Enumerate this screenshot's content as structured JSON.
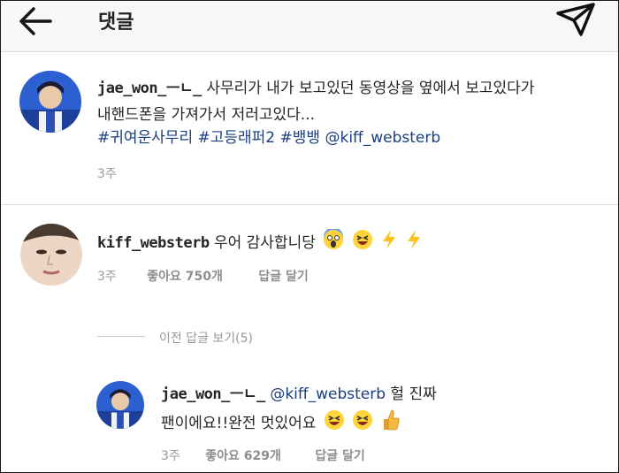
{
  "header": {
    "title": "댓글"
  },
  "caption": {
    "username": "jae_won_ㅡㄴ_",
    "text_line1": "사무리가 내가 보고있던 동영상을 옆에서 보고있다가",
    "text_line2": "내핸드폰을 가져가서 저러고있다...",
    "hashtags": [
      "#귀여운사무리",
      "#고등래퍼2",
      "#뱅뱅",
      "@kiff_websterb"
    ],
    "time": "3주"
  },
  "comment": {
    "username": "kiff_websterb",
    "text": "우어 감사합니당",
    "time": "3주",
    "likes": "좋아요 750개",
    "reply": "답글 달기"
  },
  "view_replies": "이전 답글 보기(5)",
  "reply": {
    "username": "jae_won_ㅡㄴ_",
    "mention": "@kiff_websterb",
    "text_line1_rest": "헐 진짜",
    "text_line2": "팬이에요!!완전 멋있어요",
    "time": "3주",
    "likes": "좋아요 629개",
    "reply": "답글 달기"
  }
}
